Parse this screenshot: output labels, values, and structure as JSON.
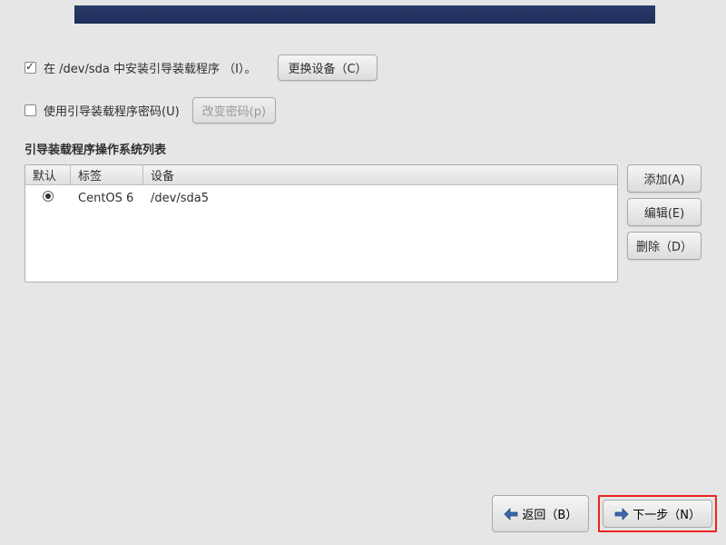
{
  "checkbox_install": {
    "checked": true,
    "label": "在 /dev/sda 中安装引导装载程序 （I）。"
  },
  "change_device_btn": "更换设备（C）",
  "checkbox_password": {
    "checked": false,
    "label": "使用引导装载程序密码(U)"
  },
  "change_password_btn": "改变密码(p)",
  "section_title": "引导装载程序操作系统列表",
  "table": {
    "headers": {
      "default": "默认",
      "label": "标签",
      "device": "设备"
    },
    "rows": [
      {
        "selected": true,
        "label": "CentOS 6",
        "device": "/dev/sda5"
      }
    ]
  },
  "side_buttons": {
    "add": "添加(A)",
    "edit": "编辑(E)",
    "delete": "删除（D）"
  },
  "nav": {
    "back": "返回（B）",
    "next": "下一步（N）"
  }
}
